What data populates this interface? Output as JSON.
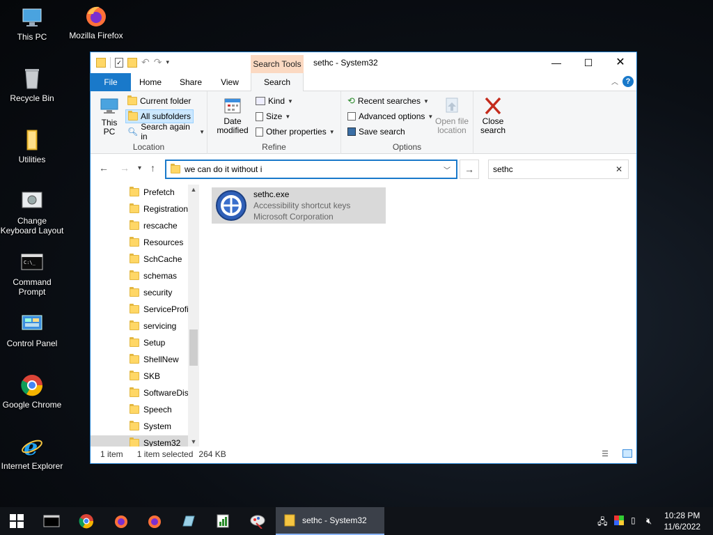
{
  "desktop": {
    "icons": [
      {
        "label": "This PC"
      },
      {
        "label": "Mozilla Firefox"
      },
      {
        "label": "Recycle Bin"
      },
      {
        "label": "Utilities"
      },
      {
        "label": "Change Keyboard Layout"
      },
      {
        "label": "Command Prompt"
      },
      {
        "label": "Control Panel"
      },
      {
        "label": "Google Chrome"
      },
      {
        "label": "Internet Explorer"
      }
    ]
  },
  "window": {
    "title": "sethc - System32",
    "context_tab": "Search Tools",
    "tabs": {
      "file": "File",
      "home": "Home",
      "share": "Share",
      "view": "View",
      "search": "Search"
    },
    "ribbon": {
      "location": {
        "this_pc": "This PC",
        "current_folder": "Current folder",
        "all_subfolders": "All subfolders",
        "search_again_in": "Search again in",
        "label": "Location"
      },
      "refine": {
        "date_modified": "Date modified",
        "kind": "Kind",
        "size": "Size",
        "other_properties": "Other properties",
        "label": "Refine"
      },
      "options": {
        "recent_searches": "Recent searches",
        "advanced_options": "Advanced options",
        "save_search": "Save search",
        "open_file_location": "Open file location",
        "label": "Options"
      },
      "close_search": "Close search"
    },
    "address": {
      "value": "we can do it without i"
    },
    "search": {
      "value": "sethc"
    },
    "nav_items": [
      {
        "label": "Prefetch"
      },
      {
        "label": "Registration"
      },
      {
        "label": "rescache"
      },
      {
        "label": "Resources"
      },
      {
        "label": "SchCache"
      },
      {
        "label": "schemas"
      },
      {
        "label": "security"
      },
      {
        "label": "ServiceProfi"
      },
      {
        "label": "servicing"
      },
      {
        "label": "Setup"
      },
      {
        "label": "ShellNew"
      },
      {
        "label": "SKB"
      },
      {
        "label": "SoftwareDis"
      },
      {
        "label": "Speech"
      },
      {
        "label": "System"
      },
      {
        "label": "System32"
      }
    ],
    "result": {
      "name": "sethc.exe",
      "description": "Accessibility shortcut keys",
      "company": "Microsoft Corporation"
    },
    "status": {
      "count": "1 item",
      "selected": "1 item selected",
      "size": "264 KB"
    }
  },
  "taskbar": {
    "active_window": "sethc - System32",
    "time": "10:28 PM",
    "date": "11/6/2022"
  },
  "colors": {
    "accent": "#1979ca",
    "search_tools": "#fbd9c2",
    "folder": "#ffd766"
  }
}
